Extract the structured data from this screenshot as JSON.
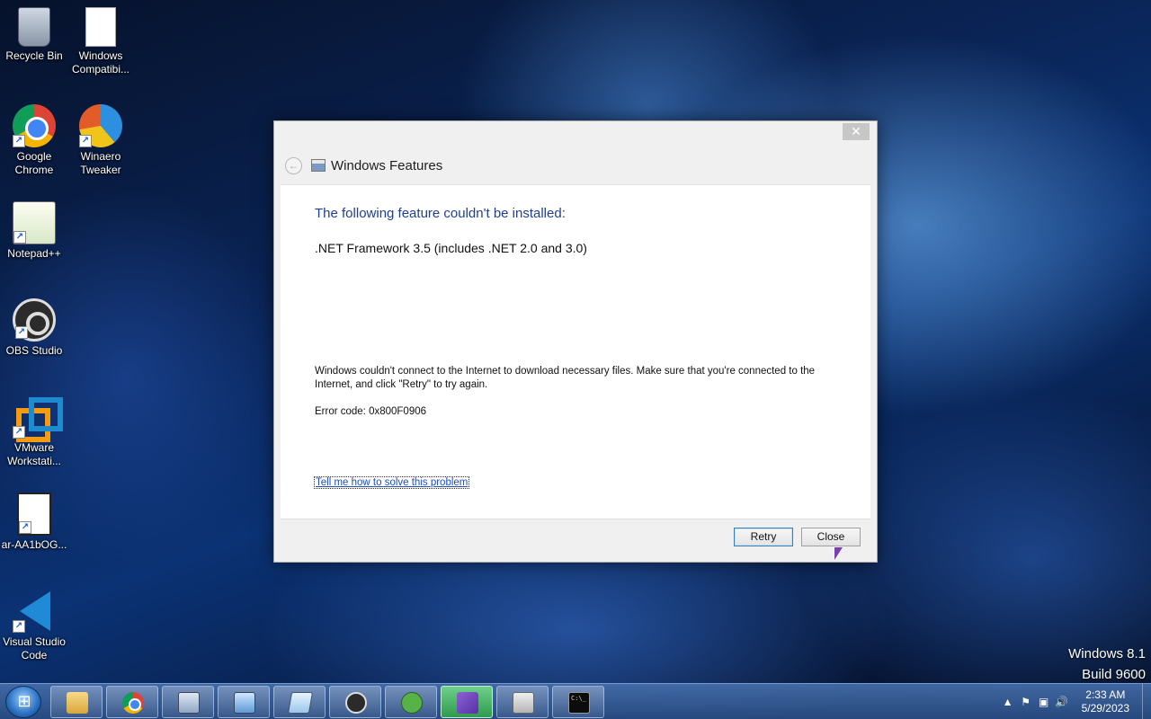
{
  "desktop_icons": [
    {
      "label": "Recycle Bin",
      "icon": "recycle-bin-icon"
    },
    {
      "label": "Windows Compatibi...",
      "icon": "document-icon"
    },
    {
      "label": "Google Chrome",
      "icon": "chrome-icon"
    },
    {
      "label": "Winaero Tweaker",
      "icon": "winaero-icon"
    },
    {
      "label": "Notepad++",
      "icon": "notepadpp-icon"
    },
    {
      "label": "OBS Studio",
      "icon": "obs-icon"
    },
    {
      "label": "VMware Workstati...",
      "icon": "vmware-icon"
    },
    {
      "label": "ar-AA1bOG...",
      "icon": "image-file-icon"
    },
    {
      "label": "Visual Studio Code",
      "icon": "vscode-icon"
    }
  ],
  "shortcut_glyph": "↗",
  "watermark": {
    "line1": "Windows 8.1",
    "line2": "Build 9600"
  },
  "dialog": {
    "close_glyph": "✕",
    "back_glyph": "←",
    "title": "Windows Features",
    "headline": "The following feature couldn't be installed:",
    "feature": ".NET Framework 3.5 (includes .NET 2.0 and 3.0)",
    "message": "Windows couldn't connect to the Internet to download necessary files. Make sure that you're connected to the Internet, and click \"Retry\" to try again.",
    "error_code": "Error code: 0x800F0906",
    "help_link": "Tell me how to solve this problem",
    "retry_label": "Retry",
    "close_label": "Close"
  },
  "taskbar": {
    "pinned": [
      {
        "name": "file-explorer",
        "icon": "folder-icon",
        "active": false
      },
      {
        "name": "chrome",
        "icon": "chrome-icon",
        "active": false
      },
      {
        "name": "system-monitor",
        "icon": "monitor-icon",
        "active": false
      },
      {
        "name": "control-panel",
        "icon": "control-panel-icon",
        "active": false
      },
      {
        "name": "notepad",
        "icon": "notepad-icon",
        "active": false
      },
      {
        "name": "obs",
        "icon": "obs-icon",
        "active": false
      },
      {
        "name": "notepadpp",
        "icon": "frog-icon",
        "active": false
      },
      {
        "name": "visual-studio-installer",
        "icon": "vs-installer-icon",
        "active": true
      },
      {
        "name": "windows-features",
        "icon": "package-icon",
        "active": false
      },
      {
        "name": "command-prompt",
        "icon": "cmd-icon",
        "active": false
      }
    ],
    "cmd_glyph": "C:\\_",
    "tray": {
      "chevron": "▲",
      "flag": "⚑",
      "network": "▣",
      "volume": "🔊"
    },
    "time": "2:33 AM",
    "date": "5/29/2023"
  }
}
